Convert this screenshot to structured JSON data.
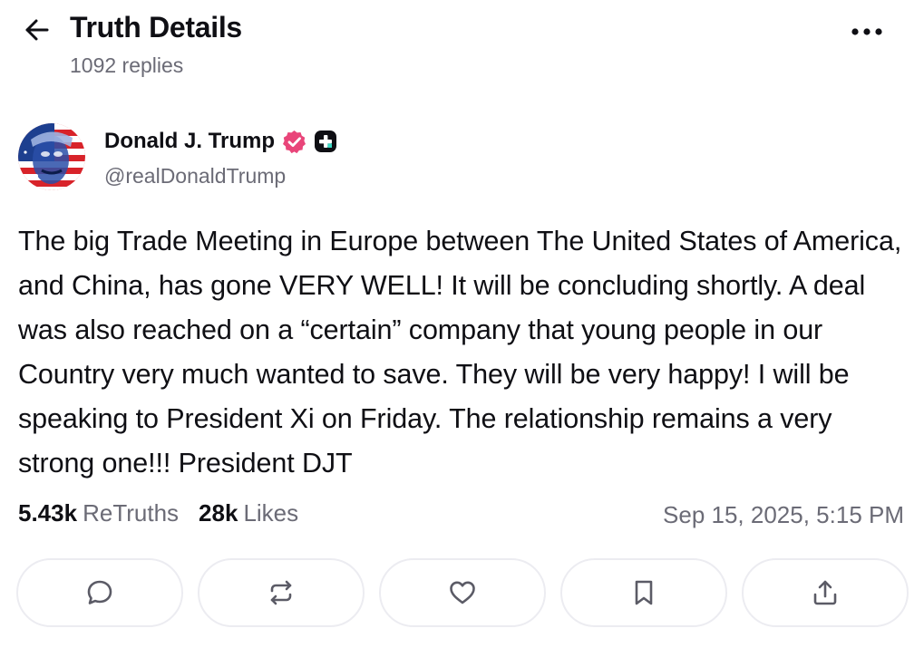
{
  "header": {
    "title": "Truth Details",
    "replies": "1092 replies",
    "back_icon": "arrow-left-icon",
    "more_icon": "more-horizontal-icon"
  },
  "post": {
    "author_name": "Donald J. Trump",
    "handle": "@realDonaldTrump",
    "verified_icon": "verified-badge-icon",
    "plus_icon": "truth-plus-icon",
    "text": "The big Trade Meeting in Europe between The United States of America, and China,  has gone VERY WELL! It will be concluding shortly. A deal was also reached on a “certain” company that young people in our Country very much wanted to save. They will be very happy! I will be speaking to President Xi on Friday. The relationship remains a very strong one!!! President DJT",
    "retruths_count": "5.43k",
    "retruths_label": "ReTruths",
    "likes_count": "28k",
    "likes_label": "Likes",
    "timestamp": "Sep 15, 2025, 5:15 PM"
  },
  "actions": [
    {
      "icon": "reply-bubble-icon"
    },
    {
      "icon": "retruth-icon"
    },
    {
      "icon": "heart-icon"
    },
    {
      "icon": "bookmark-icon"
    },
    {
      "icon": "share-icon"
    }
  ],
  "colors": {
    "text": "#0f0f14",
    "muted": "#6b6b76",
    "verified": "#e9457a",
    "button_border": "#ececf1",
    "icon": "#5b5b66"
  }
}
